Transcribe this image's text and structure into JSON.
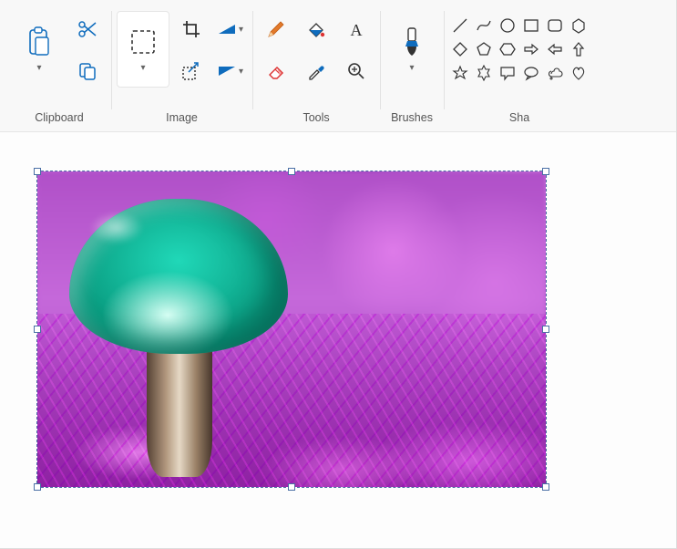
{
  "ribbon": {
    "groups": {
      "clipboard": {
        "label": "Clipboard"
      },
      "image": {
        "label": "Image"
      },
      "tools": {
        "label": "Tools"
      },
      "brushes": {
        "label": "Brushes"
      },
      "shapes": {
        "label": "Sha"
      }
    }
  },
  "icons": {
    "paste": "paste",
    "cut": "cut",
    "copy": "copy",
    "select": "select",
    "crop": "crop",
    "resize": "resize",
    "rotate_left": "rotate-left",
    "flip": "flip",
    "pencil": "pencil",
    "fill": "fill",
    "text": "text",
    "eraser": "eraser",
    "picker": "color-picker",
    "magnifier": "magnifier",
    "brush": "brush"
  },
  "colors": {
    "accent": "#0f6cbd",
    "orange": "#e27a2b",
    "red": "#d33",
    "outline": "#333"
  }
}
